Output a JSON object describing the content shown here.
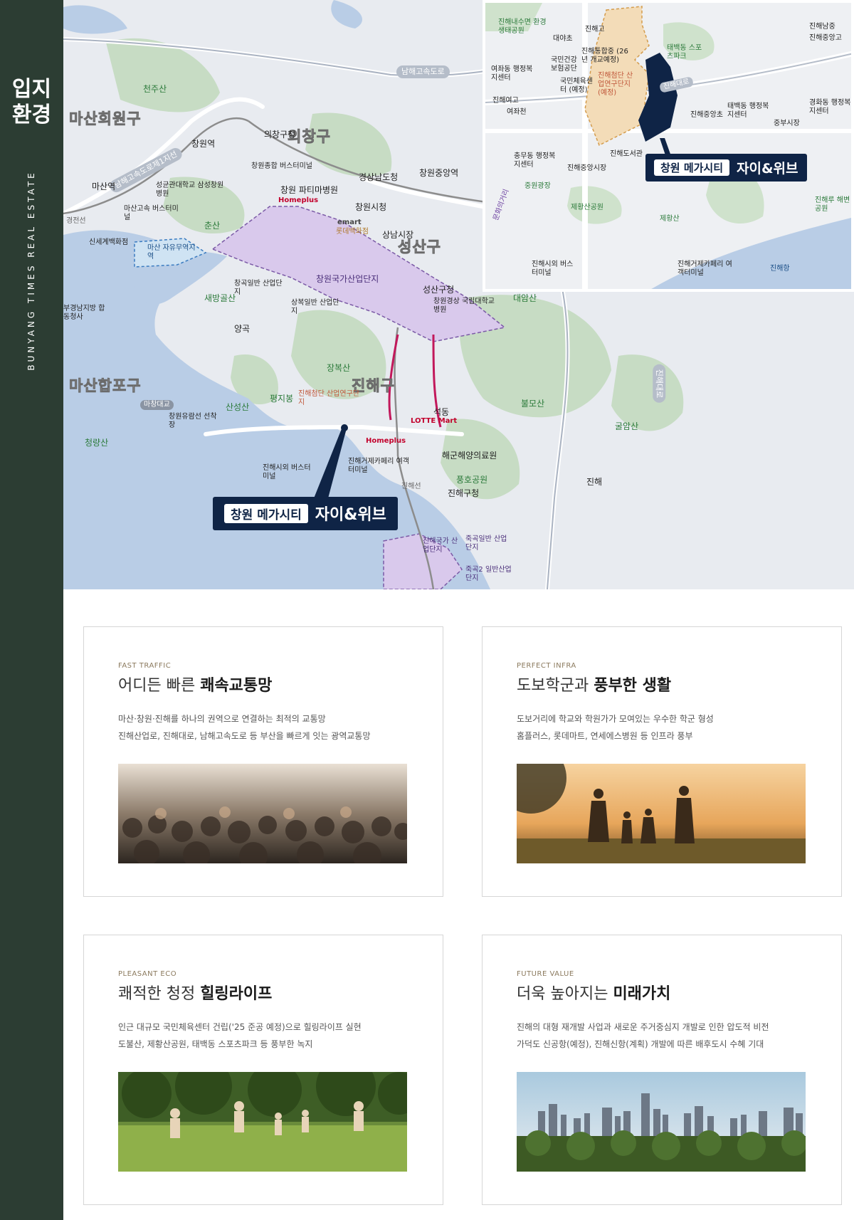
{
  "sidebar": {
    "title_line1": "입지",
    "title_line2": "환경",
    "vertical_text": "BUNYANG TIMES REAL ESTATE"
  },
  "map": {
    "roads": [
      "남해고속도로",
      "남해고속도로제1지선",
      "진해대로"
    ],
    "districts": [
      "마산회원구",
      "의창구",
      "성산구",
      "마산합포구",
      "진해구"
    ],
    "places": [
      "천주산",
      "창원역",
      "의창구청",
      "창원종합 버스터미널",
      "창원 파티마병원",
      "경상남도청",
      "창원중앙역",
      "마산역",
      "성균관대학교 삼성창원병원",
      "마산고속 버스터미널",
      "춘산",
      "창원시청",
      "상남시장",
      "신세계백화점",
      "마산 자유무역지역",
      "창원국가산업단지",
      "성산구청",
      "창원경상 국립대학교병원",
      "창곡일반 산업단지",
      "새방골산",
      "상복일반 산업단지",
      "양곡",
      "대암산",
      "장복산",
      "평지봉",
      "산성산",
      "창원유람선 선착장",
      "진해첨단 산업연구단지",
      "석동",
      "불모산",
      "굴암산",
      "청량산",
      "진해시외 버스터미널",
      "진해거제카페리 여객터미널",
      "해군해양의료원",
      "풍호공원",
      "진해구청",
      "진해국가 산업단지",
      "죽곡일반 산업단지",
      "죽곡2 일반산업단지",
      "진해",
      "진해선",
      "마창대교",
      "경전선",
      "부경남지방 합동청사"
    ],
    "brands": [
      "Homeplus",
      "emart",
      "롯데백화점",
      "LOTTE Mart"
    ],
    "callout": {
      "chip": "창원 메가시티",
      "name": "자이&위브"
    },
    "inset": {
      "places": [
        "진해내수면 환경생태공원",
        "진해고",
        "대야초",
        "국민건강 보험공단",
        "진해통합중 (26년 개교예정)",
        "여좌동 행정복지센터",
        "국민체육센터 (예정)",
        "진해첨단 산업연구단지 (예정)",
        "진해여고",
        "여좌천",
        "태백동 스포츠파크",
        "진해중앙고",
        "진해남중",
        "진해중앙초",
        "태백동 행정복지센터",
        "중부시장",
        "경화동 행정복지센터",
        "충무동 행정복지센터",
        "진해중앙시장",
        "진해도서관",
        "중원광장",
        "제황산공원",
        "제황산",
        "진해루 해변공원",
        "진해시외 버스터미널",
        "진해거제카페리 여객터미널",
        "진해항",
        "문화의거리",
        "진해대로"
      ],
      "callout": {
        "chip": "창원 메가시티",
        "name": "자이&위브"
      }
    }
  },
  "cards": [
    {
      "eyebrow": "FAST TRAFFIC",
      "head_light": "어디든 빠른 ",
      "head_bold": "쾌속교통망",
      "desc1": "마산·창원·진해를 하나의 권역으로 연결하는 최적의 교통망",
      "desc2": "진해산업로, 진해대로, 남해고속도로 등 부산을 빠르게 잇는 광역교통망",
      "photo": "crowd"
    },
    {
      "eyebrow": "PERFECT INFRA",
      "head_light": "도보학군과 ",
      "head_bold": "풍부한 생활",
      "desc1": "도보거리에 학교와 학원가가 모여있는 우수한 학군 형성",
      "desc2": "홈플러스, 롯데마트, 연세에스병원 등 인프라 풍부",
      "photo": "family"
    },
    {
      "eyebrow": "PLEASANT ECO",
      "head_light": "쾌적한 청정 ",
      "head_bold": "힐링라이프",
      "desc1": "인근 대규모 국민체육센터 건립('25 준공 예정)으로 힐링라이프 실현",
      "desc2": "도불산, 제황산공원, 태백동 스포츠파크 등 풍부한 녹지",
      "photo": "kids"
    },
    {
      "eyebrow": "FUTURE VALUE",
      "head_light": "더욱 높아지는 ",
      "head_bold": "미래가치",
      "desc1": "진해의 대형 재개발 사업과 새로운 주거중심지 개발로 인한 압도적 비전",
      "desc2": "가덕도 신공항(예정), 진해신항(계획) 개발에 따른 배후도시 수혜 기대",
      "photo": "city"
    }
  ]
}
